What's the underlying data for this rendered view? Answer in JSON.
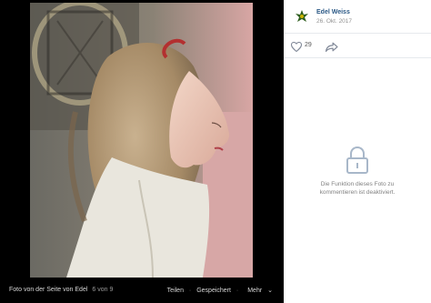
{
  "viewer": {
    "photo_alt": "portrait-photo",
    "caption": "Foto von der Seite von Edel",
    "counter": "6 von 9",
    "share_label": "Teilen",
    "dot": "·",
    "saved_label": "Gespeichert",
    "more_label": "Mehr",
    "more_chevron": "⌄"
  },
  "sidebar": {
    "author": "Edel Weiss",
    "date": "26. Okt. 2017",
    "likes": "29",
    "comments_disabled": "Die Funktion dieses Foto zu kommentieren ist deaktiviert.",
    "link_color": "#2a5885"
  }
}
